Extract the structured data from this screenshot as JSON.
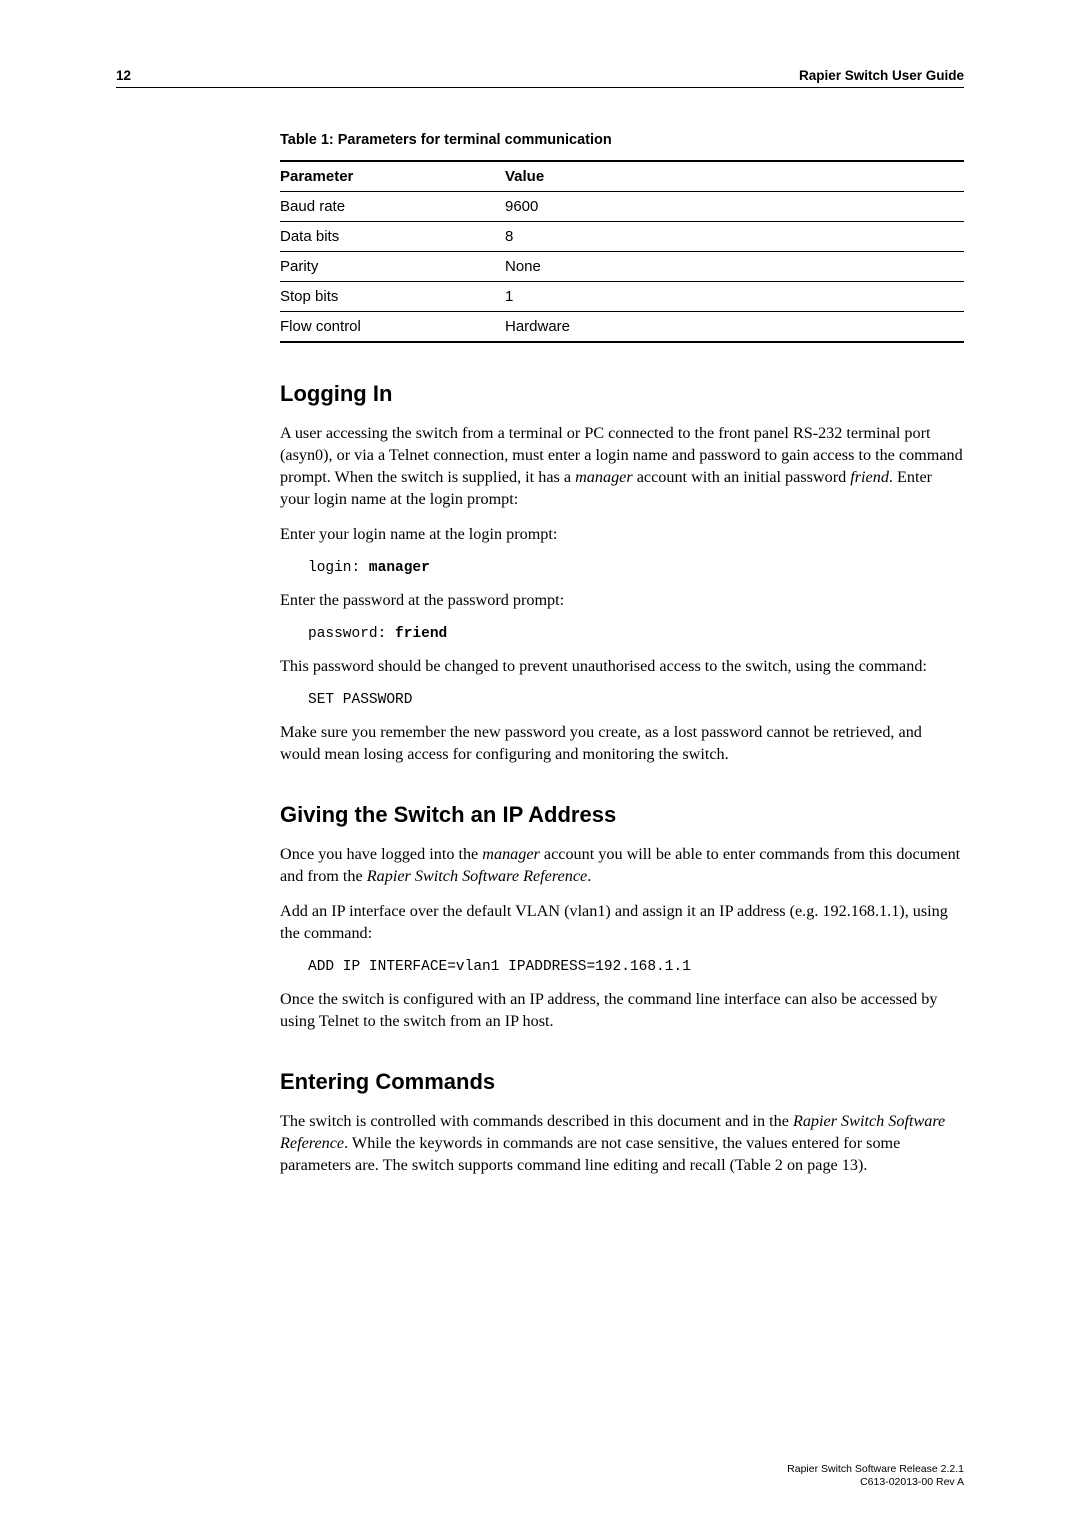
{
  "header": {
    "page_number": "12",
    "doc_title": "Rapier Switch User Guide"
  },
  "table": {
    "caption": "Table 1: Parameters for terminal communication",
    "head_param": "Parameter",
    "head_value": "Value",
    "rows": [
      {
        "param": "Baud rate",
        "value": "9600"
      },
      {
        "param": "Data bits",
        "value": "8"
      },
      {
        "param": "Parity",
        "value": "None"
      },
      {
        "param": "Stop bits",
        "value": "1"
      },
      {
        "param": "Flow control",
        "value": "Hardware"
      }
    ]
  },
  "sections": {
    "logging_in": {
      "title": "Logging In",
      "p1a": "A user accessing the switch from a terminal or PC connected to the front panel RS-232 terminal port (asyn0), or via a Telnet connection, must enter a login name and password to gain access to the command prompt. When the switch is supplied, it has a ",
      "p1_em1": "manager",
      "p1b": " account with an initial password ",
      "p1_em2": "friend",
      "p1c": ". Enter your login name at the login prompt:",
      "p2": "Enter your login name at the login prompt:",
      "code1_prefix": "login: ",
      "code1_bold": "manager",
      "p3": "Enter the password at the password prompt:",
      "code2_prefix": "password: ",
      "code2_bold": "friend",
      "p4": "This password should be changed to prevent unauthorised access to the switch, using the command:",
      "code3": "SET PASSWORD",
      "p5": "Make sure you remember the new password you create, as a lost password cannot be retrieved, and would mean losing access for configuring and monitoring the switch."
    },
    "ip_address": {
      "title": "Giving the Switch an IP Address",
      "p1a": "Once you have logged into the ",
      "p1_em1": "manager",
      "p1b": " account you will be able to enter commands from this document and from the ",
      "p1_em2": "Rapier Switch Software Reference",
      "p1c": ".",
      "p2": "Add an IP interface over the default VLAN (vlan1) and assign it an IP address (e.g. 192.168.1.1), using the command:",
      "code1": "ADD IP INTERFACE=vlan1 IPADDRESS=192.168.1.1",
      "p3": "Once the switch is configured with an IP address, the command line interface can also be accessed by using Telnet to the switch from an IP host."
    },
    "entering_commands": {
      "title": "Entering Commands",
      "p1a": "The switch is controlled with commands described in this document and in the ",
      "p1_em1": "Rapier Switch Software Reference",
      "p1b": ". While the keywords in commands are not case sensitive, the values entered for some parameters are. The switch supports command line editing and recall (Table 2 on page 13)."
    }
  },
  "footer": {
    "line1": "Rapier Switch Software Release 2.2.1",
    "line2": "C613-02013-00 Rev A"
  }
}
